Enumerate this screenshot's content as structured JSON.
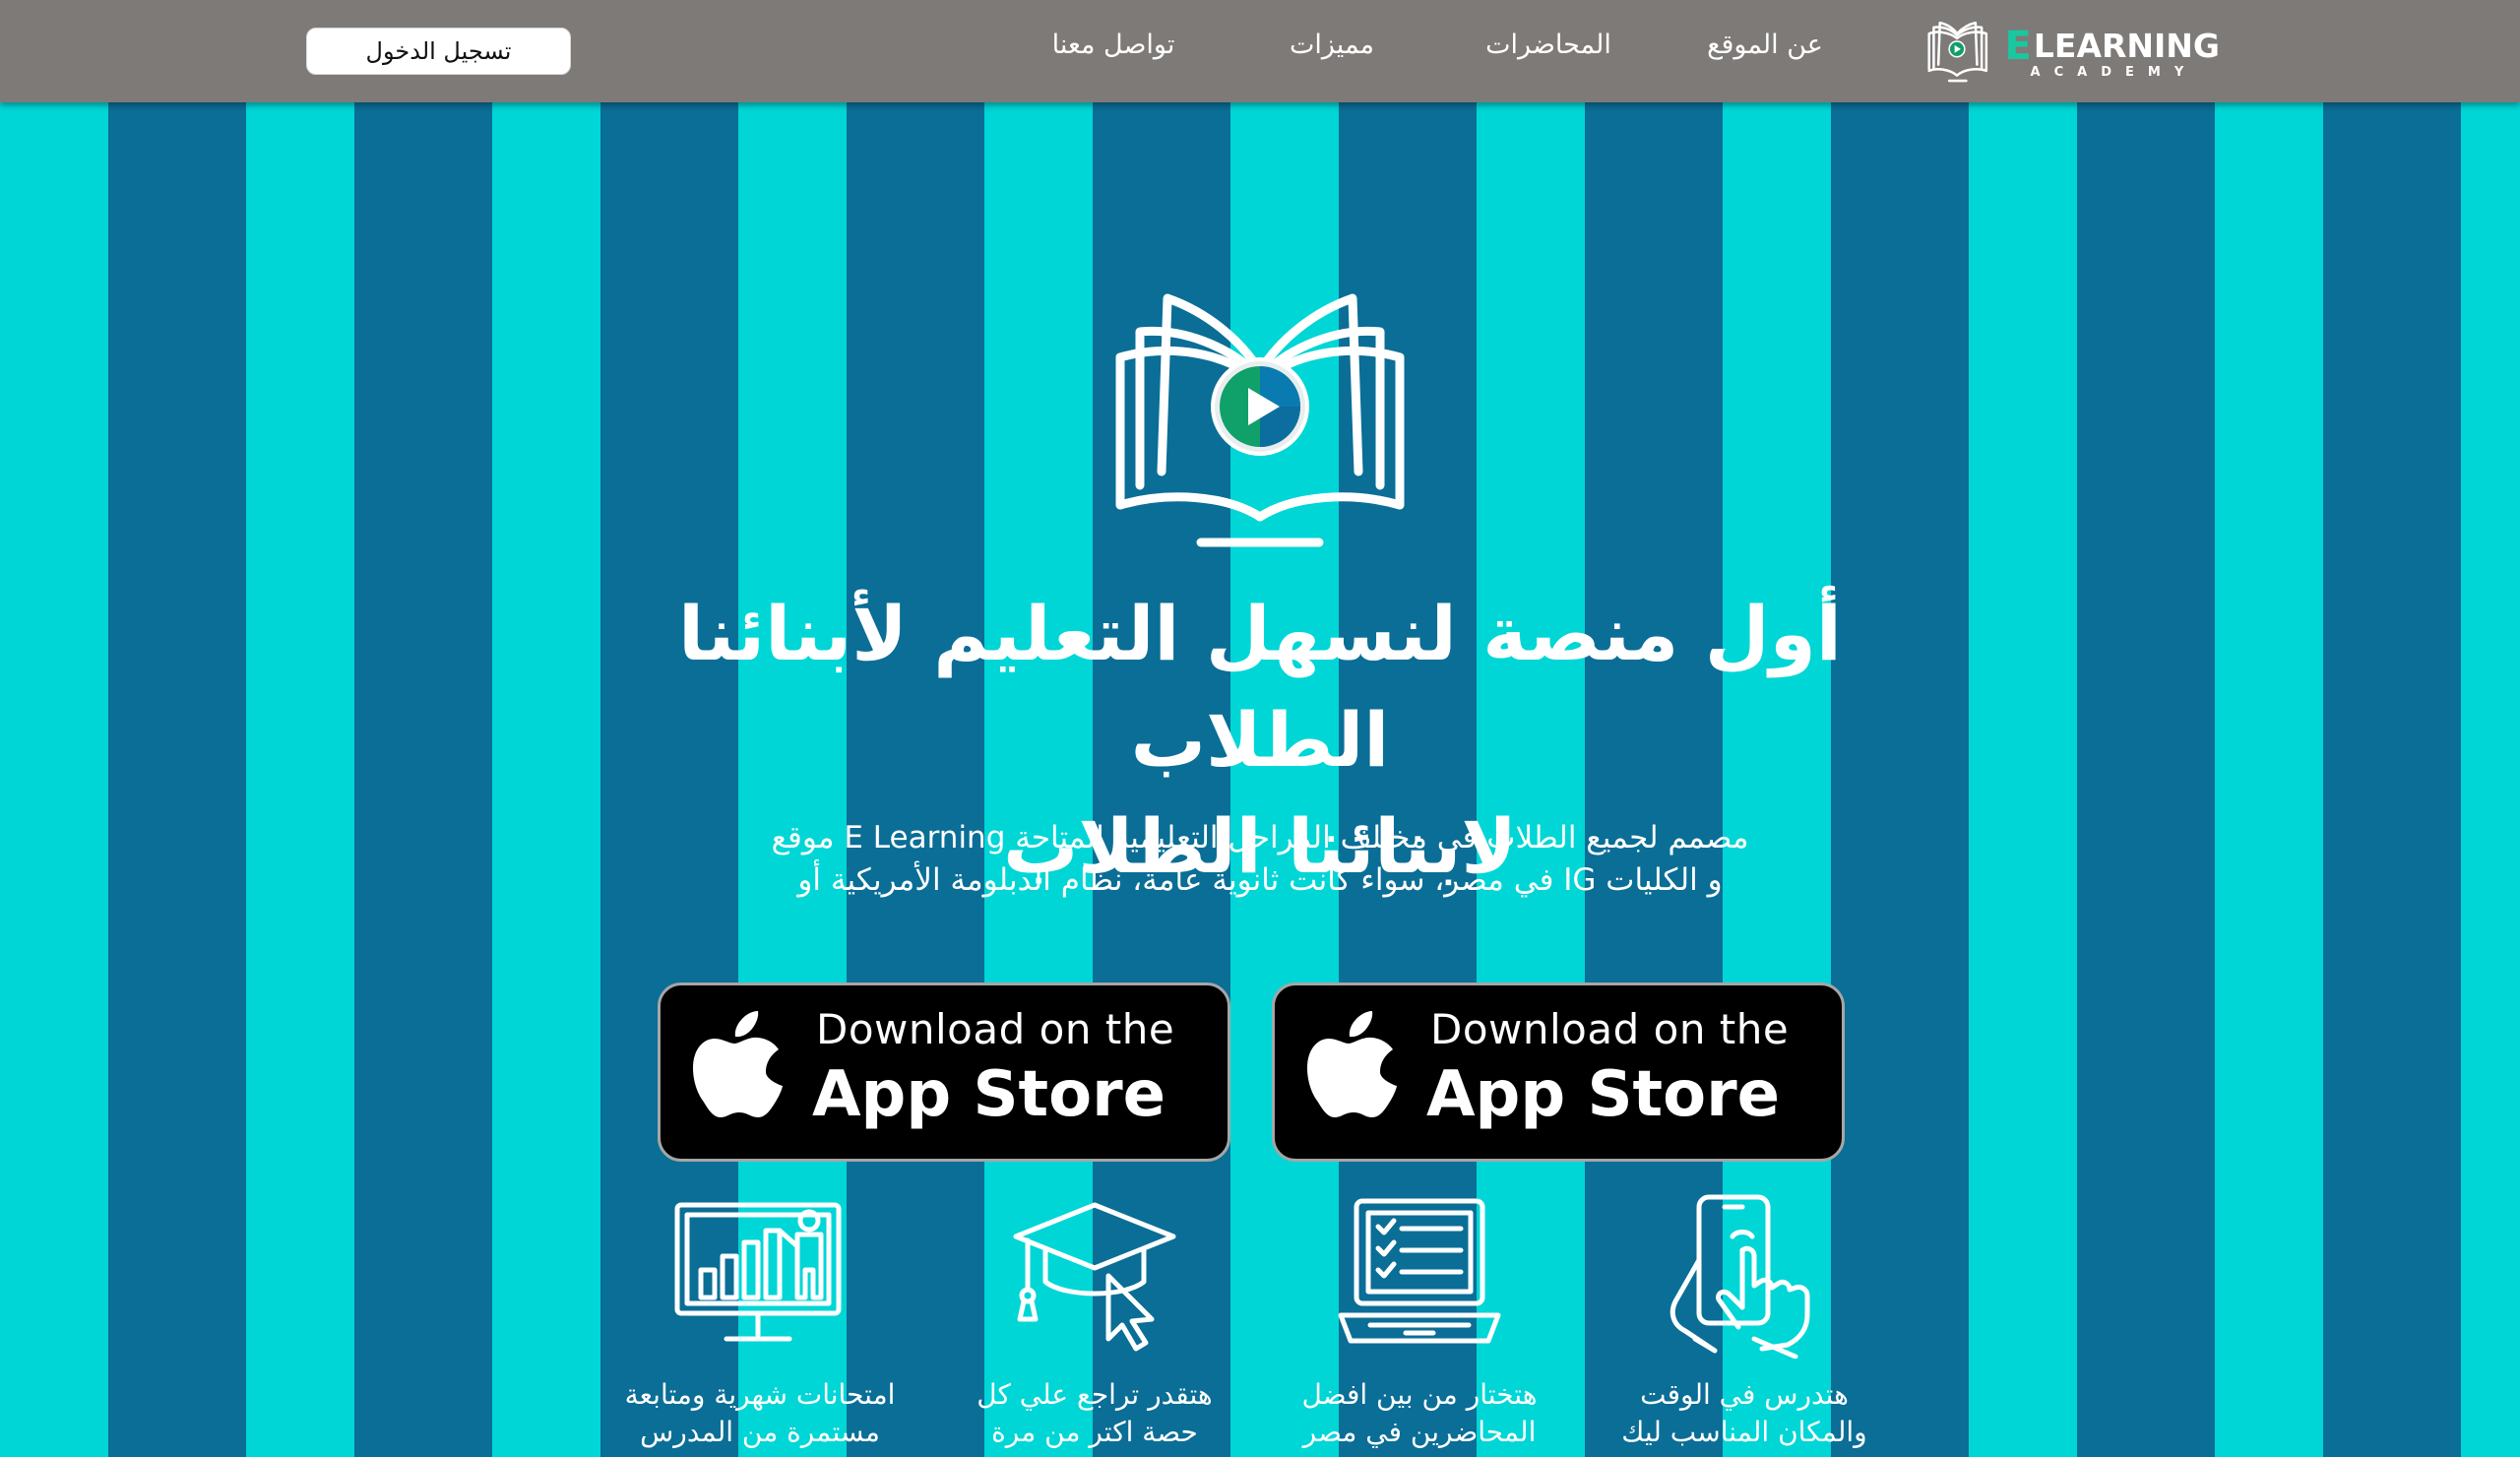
{
  "nav": {
    "login_label": "تسجيل الدخول",
    "links": [
      "تواصل معنا",
      "مميزات",
      "المحاضرات",
      "عن الموقع"
    ],
    "logo": {
      "letter": "E",
      "main": "LEARNING",
      "sub": "ACADEMY"
    }
  },
  "hero": {
    "title_line1": "أول منصة لنسهل التعليم لأبنائنا الطلاب",
    "title_line2": "لابنائنا الطلاب",
    "desc_line1": "مصمم لجميع الطلاب في مختلف المراحل التعليمية المتاحة E Learning موقع",
    "desc_line2": "و الكليات IG في مصر، سواء كانت ثانوية عامة، نظام الدبلومة الأمريكية أو"
  },
  "store_buttons": [
    {
      "small": "Download on the",
      "big": "App Store"
    },
    {
      "small": "Download on the",
      "big": "App Store"
    }
  ],
  "features": [
    {
      "icon": "presentation-chart-icon",
      "line1": "امتحانات شهرية ومتابعة",
      "line2": "مستمرة من المدرس"
    },
    {
      "icon": "graduation-cap-cursor-icon",
      "line1": "هتقدر تراجع علي كل",
      "line2": "حصة اكتر من مرة"
    },
    {
      "icon": "laptop-checklist-icon",
      "line1": "هتختار من بين افضل",
      "line2": "المحاضرين في مصر"
    },
    {
      "icon": "phone-touch-icon",
      "line1": "هتدرس في الوقت",
      "line2": "والمكان المناسب ليك"
    }
  ],
  "colors": {
    "stripe_light": "#00d6d6",
    "stripe_dark": "#0a6e96",
    "navbar": "#7e7a78",
    "logo_accent": "#18c8a0"
  }
}
